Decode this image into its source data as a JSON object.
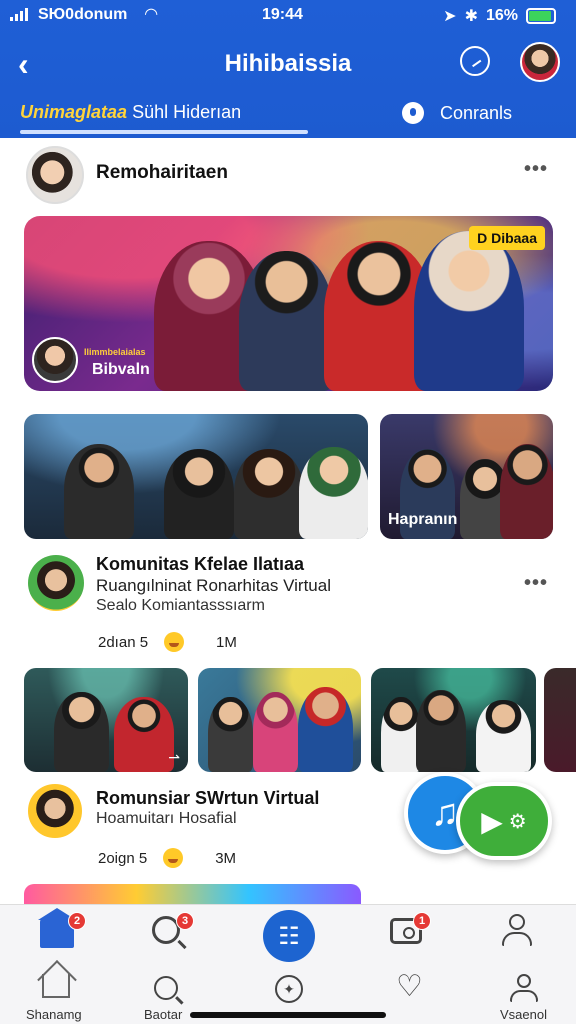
{
  "status_bar": {
    "carrier": "SЮ0donum",
    "time": "19:44",
    "battery": "16%"
  },
  "header": {
    "title": "Hihibaissia",
    "tab_brand": "Unimaglataa",
    "tab_rest": "Sühl Hiderıan",
    "tab_comments": "Conranls"
  },
  "post": {
    "author": "Remohairitaen",
    "hero_badge": "D Dibaaa",
    "hero_tag": "Ilimmbelaialas",
    "hero_label": "Bibvaln"
  },
  "side_photo_label": "Hapranın",
  "group": {
    "title": "Komunitas Kfelae Ilatıaa",
    "subtitle": "Ruangılninat Ronarhitas Virtual",
    "subtitle2": "Sealo Komiantasssıarm",
    "time": "2dıan 5",
    "count": "1M"
  },
  "room": {
    "title": "Romunsiar SWrtun Virtual",
    "subtitle": "Hoamuitarı Hosafial",
    "time": "2oign 5",
    "count": "3M"
  },
  "bottom_nav": {
    "badges": [
      "2",
      "3",
      "1"
    ],
    "labels": [
      "Shanamg",
      "Baotar",
      "Vsaenol"
    ]
  },
  "colors": {
    "header_bg": "#1d5bd0",
    "accent_blue": "#1e88e5",
    "accent_green": "#3fae3a",
    "badge_red": "#e53935",
    "brand_yellow": "#ffd43b"
  },
  "icons": {
    "back": "chevron-left-icon",
    "header_action": "compass-icon",
    "comments": "chat-bubble-icon",
    "music": "music-note-icon",
    "play": "play-icon",
    "settings": "gear-icon"
  }
}
